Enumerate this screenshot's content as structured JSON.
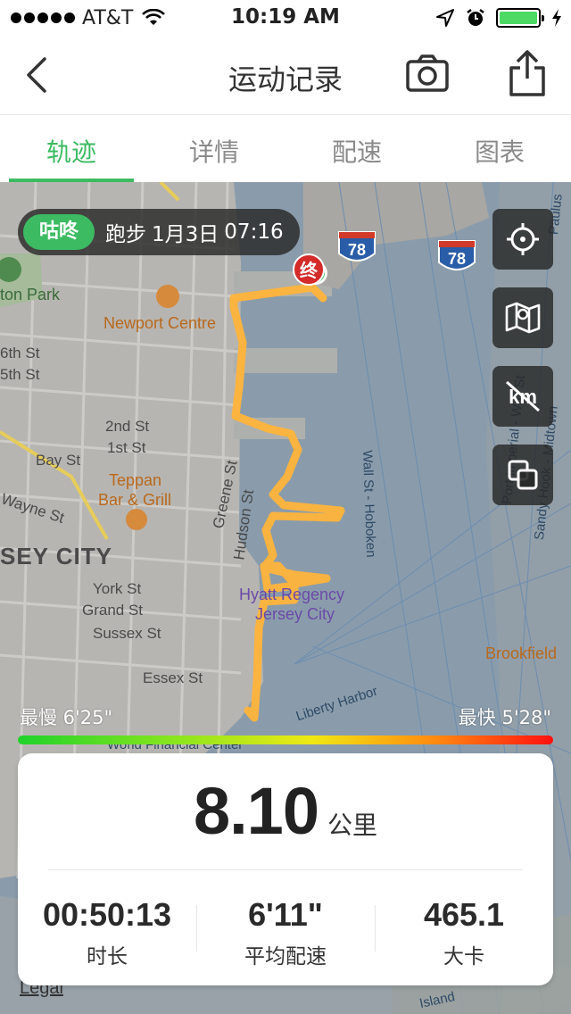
{
  "status_bar": {
    "carrier": "AT&T",
    "time": "10:19 AM",
    "battery_level": 1.0
  },
  "nav": {
    "title": "运动记录"
  },
  "tabs": [
    {
      "label": "轨迹",
      "active": true
    },
    {
      "label": "详情",
      "active": false
    },
    {
      "label": "配速",
      "active": false
    },
    {
      "label": "图表",
      "active": false
    }
  ],
  "map": {
    "info": {
      "brand": "咕咚",
      "activity": "跑步",
      "date": "1月3日",
      "time": "07:16"
    },
    "end_marker": "终",
    "labels": {
      "park": "ton Park",
      "newport": "Newport Centre",
      "sixth": "6th St",
      "fifth": "5th St",
      "second": "2nd St",
      "first": "1st St",
      "bay": "Bay St",
      "teppan": "Teppan",
      "bar_grill": "Bar & Grill",
      "wayne": "Wayne St",
      "city": "SEY CITY",
      "greene": "Greene St",
      "hudson": "Hudson St",
      "york": "York St",
      "grand": "Grand St",
      "sussex": "Sussex St",
      "essex": "Essex St",
      "hyatt1": "Hyatt Regency",
      "hyatt2": "Jersey City",
      "wall_st": "Wall St - Hoboken",
      "port": "Port Imperial - Wall St",
      "sandy": "Sandy Hook - Midtown",
      "paulus": "Paulus",
      "brookfield": "Brookfield",
      "liberty": "Liberty Harbor",
      "wfc": "World Financial Center",
      "island": "Island",
      "highway_shield": "78",
      "legal": "Legal"
    },
    "km_toggle_label": "km",
    "pace": {
      "slowest": "最慢 6'25\"",
      "fastest": "最快 5'28\""
    }
  },
  "stats": {
    "distance": "8.10",
    "distance_unit": "公里",
    "items": [
      {
        "value": "00:50:13",
        "label": "时长"
      },
      {
        "value": "6'11\"",
        "label": "平均配速"
      },
      {
        "value": "465.1",
        "label": "大卡"
      }
    ]
  },
  "colors": {
    "accent": "#3dbb63",
    "route": "#ffb43a",
    "end_marker": "#d42a2a"
  }
}
